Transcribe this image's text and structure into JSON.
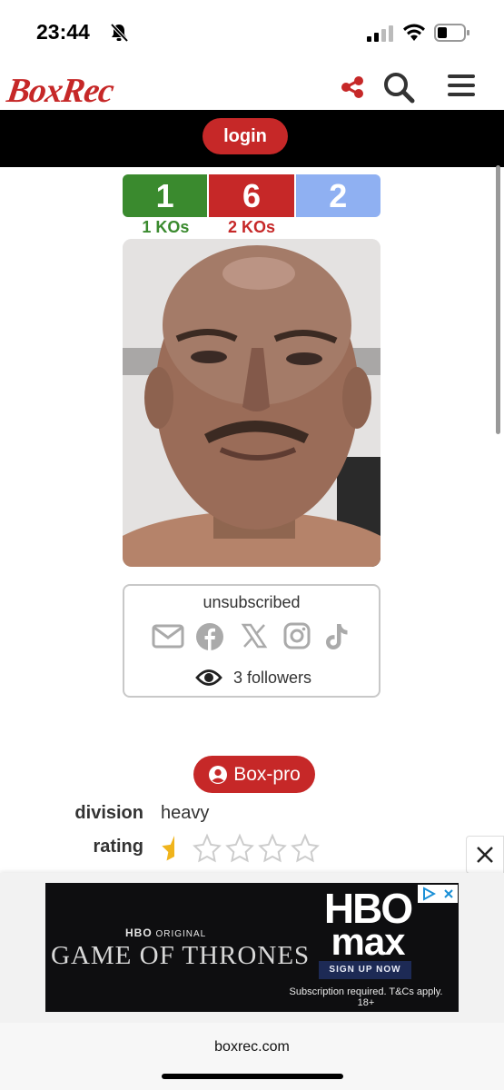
{
  "status_bar": {
    "time": "23:44",
    "icons": [
      "bell-slash-icon",
      "signal-icon",
      "wifi-icon",
      "battery-icon"
    ]
  },
  "header": {
    "logo": "BoxRec",
    "icons": [
      "share-icon",
      "search-icon",
      "menu-icon"
    ]
  },
  "login": {
    "label": "login"
  },
  "record": {
    "wins": "1",
    "losses": "6",
    "draws": "2",
    "win_kos": "1 KOs",
    "loss_kos": "2 KOs"
  },
  "social": {
    "status": "unsubscribed",
    "icons": [
      "email-icon",
      "facebook-icon",
      "x-icon",
      "instagram-icon",
      "tiktok-icon"
    ],
    "followers": "3 followers"
  },
  "profile": {
    "category_button": "Box-pro",
    "details": [
      {
        "label": "division",
        "value": "heavy"
      },
      {
        "label": "rating",
        "value": ""
      }
    ],
    "rating_stars": 0.5,
    "rating_max": 5
  },
  "ad": {
    "network_badge": "HBO",
    "original_label": "ORIGINAL",
    "show_title": "GAME OF THRONES",
    "brand_line1": "HBO",
    "brand_line2": "max",
    "cta": "SIGN UP NOW",
    "terms": "Subscription required. T&Cs apply. 18+"
  },
  "browser": {
    "url": "boxrec.com"
  },
  "colors": {
    "brand_red": "#c62828",
    "win_green": "#3a8a2e",
    "draw_blue": "#8fb0f2",
    "icon_gray": "#aaaaaa"
  }
}
